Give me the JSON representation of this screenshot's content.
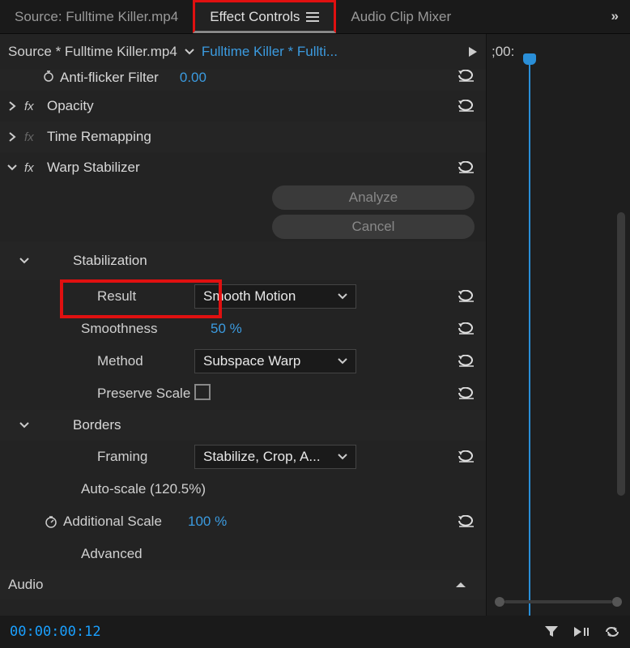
{
  "tabs": {
    "source": "Source: Fulltime Killer.mp4",
    "effect_controls": "Effect Controls",
    "audio_mixer": "Audio Clip Mixer",
    "overflow": "»"
  },
  "source_row": {
    "source": "Source * Fulltime Killer.mp4",
    "sequence": "Fulltime Killer * Fullti...",
    "timecode_snip": ";00:"
  },
  "effects": {
    "anti_flicker": {
      "label": "Anti-flicker Filter",
      "value": "0.00"
    },
    "opacity": {
      "label": "Opacity"
    },
    "time_remapping": {
      "label": "Time Remapping"
    },
    "warp_stabilizer": {
      "label": "Warp Stabilizer",
      "analyze": "Analyze",
      "cancel": "Cancel",
      "stabilization": {
        "label": "Stabilization",
        "result": {
          "label": "Result",
          "value": "Smooth Motion"
        },
        "smoothness": {
          "label": "Smoothness",
          "value": "50 %"
        },
        "method": {
          "label": "Method",
          "value": "Subspace Warp"
        },
        "preserve_scale": {
          "label": "Preserve Scale"
        }
      },
      "borders": {
        "label": "Borders",
        "framing": {
          "label": "Framing",
          "value": "Stabilize, Crop, A..."
        },
        "auto_scale": "Auto-scale (120.5%)",
        "additional_scale": {
          "label": "Additional Scale",
          "value": "100 %"
        }
      },
      "advanced": "Advanced"
    }
  },
  "audio_section": "Audio",
  "bottom": {
    "timecode": "00:00:00:12"
  }
}
